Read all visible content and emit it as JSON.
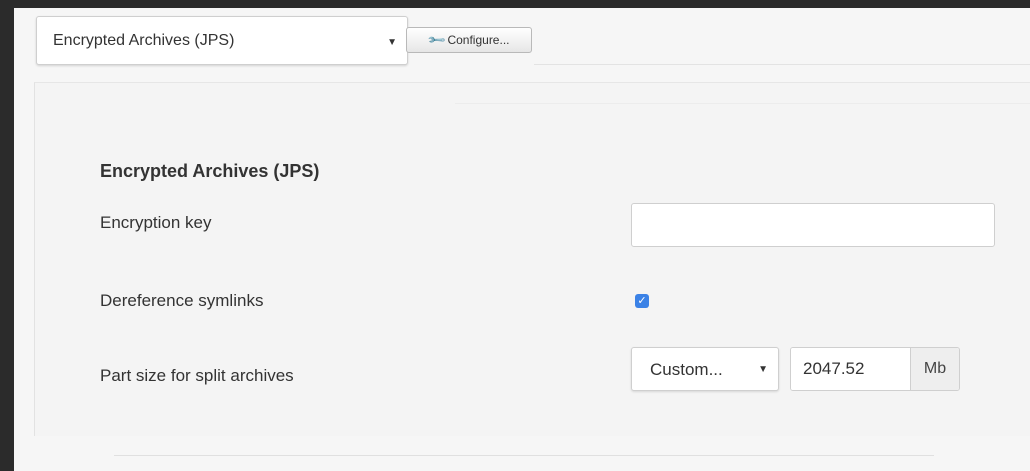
{
  "toolbar": {
    "engine_label": "Encrypted Archives (JPS)",
    "configure_label": "Configure..."
  },
  "panel": {
    "title": "Encrypted Archives (JPS)",
    "encryption_key": {
      "label": "Encryption key",
      "value": ""
    },
    "dereference_symlinks": {
      "label": "Dereference symlinks",
      "checked": true
    },
    "part_size": {
      "label": "Part size for split archives",
      "preset": "Custom...",
      "value": "2047.52",
      "unit": "Mb"
    }
  },
  "colors": {
    "accent": "#3b82e6",
    "frame": "#2e2e2e",
    "background": "#f6f6f6"
  }
}
